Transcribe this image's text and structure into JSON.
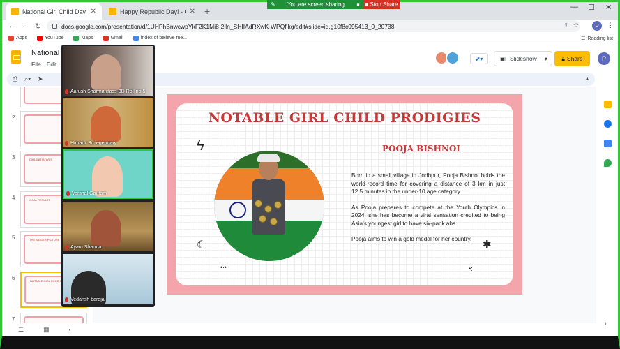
{
  "browser": {
    "tabs": [
      {
        "title": "National Girl Child Day - Google",
        "active": true
      },
      {
        "title": "Happy Republic Day! - Google Sl",
        "active": false
      }
    ],
    "new_tab": "+",
    "url": "docs.google.com/presentation/d/1UHPhBnwcwpYkF2K1Mi8-2iln_SHIIAdRXwK-WPQflkg/edit#slide=id.g10f8c095413_0_20738",
    "profile_letter": "P",
    "bookmarks": [
      "Apps",
      "YouTube",
      "Maps",
      "Gmail",
      "index of believe me..."
    ],
    "reading_list": "Reading list"
  },
  "screen_share": {
    "message": "You are screen sharing",
    "stop_label": "Stop Share"
  },
  "slides_app": {
    "doc_title": "National C",
    "menu": [
      "File",
      "Edit"
    ],
    "slideshow_label": "Slideshow",
    "share_label": "Share",
    "user_letter": "P"
  },
  "filmstrip": {
    "slides": [
      {
        "num": "2",
        "title": ""
      },
      {
        "num": "3",
        "title": "GIRL INITIATIVES"
      },
      {
        "num": "4",
        "title": "GOAL RESULTS"
      },
      {
        "num": "5",
        "title": "THE BIGGER PICTURE"
      },
      {
        "num": "6",
        "title": "NOTABLE GIRL CHILD PRODIGIES"
      },
      {
        "num": "7",
        "title": ""
      }
    ],
    "selected": "6"
  },
  "slide": {
    "title": "NOTABLE GIRL CHILD PRODIGIES",
    "subtitle": "POOJA BISHNOI",
    "paragraphs": [
      "Born in a small village in Jodhpur, Pooja Bishnoi holds the world-record time for covering a distance of 3 km in just 12.5 minutes in the under-10 age category.",
      "As Pooja prepares to compete at the Youth Olympics in 2024, she has become a viral sensation credited to being Asia's youngest girl to have six-pack abs.",
      "Pooja aims to win a gold medal for her country."
    ]
  },
  "participants": [
    {
      "name": "Aarush Sharma class-3D Roll no 5"
    },
    {
      "name": "Himank 3d legendary"
    },
    {
      "name": "Varshal Gautam"
    },
    {
      "name": "Ayam Sharma"
    },
    {
      "name": "Vedansh bareja"
    }
  ],
  "colors": {
    "accent_green": "#34c73a",
    "slide_pink": "#f4a5ac",
    "title_red": "#c23b3b",
    "share_yellow": "#fbbc04"
  }
}
